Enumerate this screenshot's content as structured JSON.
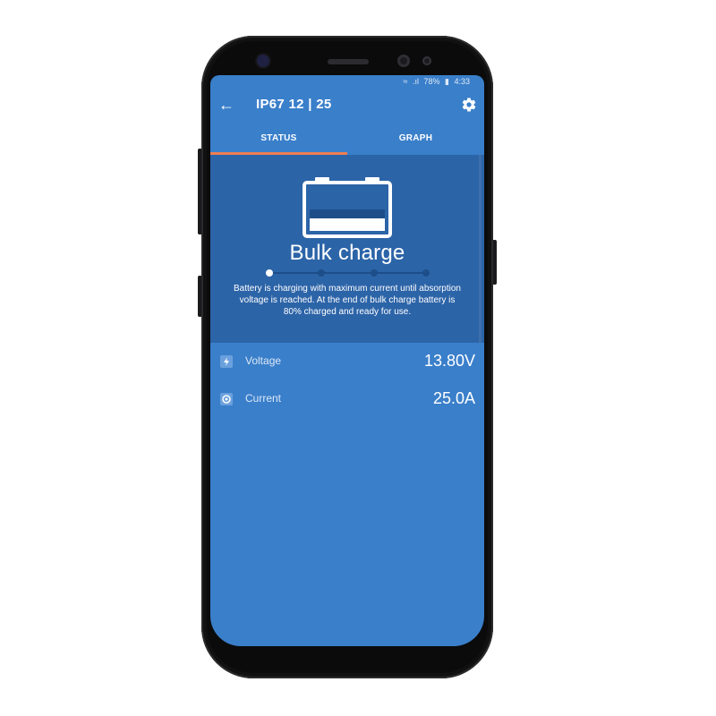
{
  "status_bar": {
    "battery_percent": "78%",
    "time": "4:33"
  },
  "appbar": {
    "title": "IP67 12 | 25"
  },
  "tabs": [
    {
      "label": "STATUS",
      "selected": true
    },
    {
      "label": "GRAPH",
      "selected": false
    }
  ],
  "charge_state": {
    "title": "Bulk charge",
    "description": "Battery is charging with maximum current until absorption voltage is reached. At the end of bulk charge battery is  80% charged and ready for use.",
    "steps_total": 4,
    "active_step": 1
  },
  "readings": [
    {
      "label": "Voltage",
      "value": "13.80V",
      "icon": "lightning-icon"
    },
    {
      "label": "Current",
      "value": "25.0A",
      "icon": "current-icon"
    }
  ],
  "colors": {
    "screen_bg": "#3a7fca",
    "hero_bg": "#2c64a8",
    "tab_indicator": "#ef7e52"
  }
}
